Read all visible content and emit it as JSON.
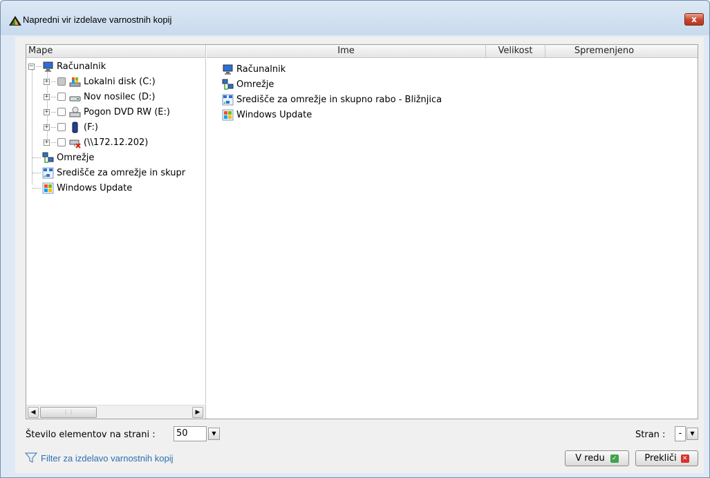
{
  "window": {
    "title": "Napredni vir izdelave varnostnih kopij",
    "close_label": "x"
  },
  "tree": {
    "header": "Mape",
    "items": [
      {
        "label": "Računalnik",
        "icon": "computer-icon"
      },
      {
        "label": "Lokalni disk (C:)",
        "icon": "system-drive-icon"
      },
      {
        "label": "Nov nosilec (D:)",
        "icon": "drive-icon"
      },
      {
        "label": "Pogon DVD RW (E:)",
        "icon": "dvd-drive-icon"
      },
      {
        "label": "(F:)",
        "icon": "usb-drive-icon"
      },
      {
        "label": "(\\\\172.12.202)",
        "icon": "disconnected-network-drive-icon"
      },
      {
        "label": "Omrežje",
        "icon": "network-icon"
      },
      {
        "label": "Središče za omrežje in skupr",
        "icon": "network-center-icon"
      },
      {
        "label": "Windows Update",
        "icon": "windows-update-icon"
      }
    ]
  },
  "list": {
    "columns": [
      "Ime",
      "Velikost",
      "Spremenjeno"
    ],
    "rows": [
      {
        "name": "Računalnik",
        "icon": "computer-icon"
      },
      {
        "name": "Omrežje",
        "icon": "network-icon"
      },
      {
        "name": "Središče za omrežje in skupno rabo - Bližnjica",
        "icon": "network-center-icon"
      },
      {
        "name": "Windows Update",
        "icon": "windows-update-icon"
      }
    ]
  },
  "footer": {
    "per_page_label": "Število elementov na strani :",
    "per_page_value": "50",
    "page_label": "Stran :",
    "page_value": "-",
    "filter_link": "Filter za izdelavo varnostnih kopij",
    "ok_label": "V redu",
    "cancel_label": "Prekliči"
  },
  "colors": {
    "link": "#2a6fb2",
    "ok_icon": "#3da44d",
    "cancel_icon": "#d8322a",
    "close_button": "#c7452c"
  }
}
